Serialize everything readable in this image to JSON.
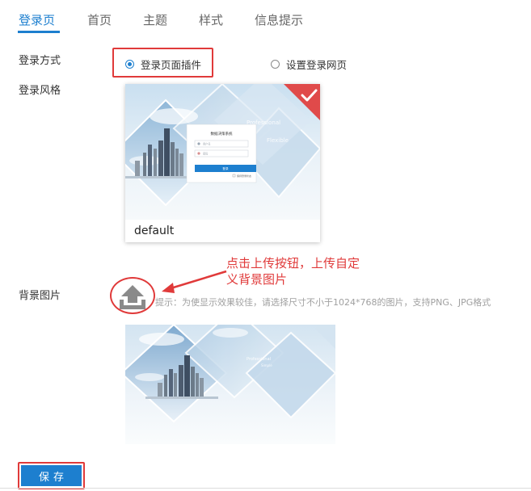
{
  "tabs": [
    {
      "label": "登录页",
      "active": true
    },
    {
      "label": "首页",
      "active": false
    },
    {
      "label": "主题",
      "active": false
    },
    {
      "label": "样式",
      "active": false
    },
    {
      "label": "信息提示",
      "active": false
    }
  ],
  "login_method": {
    "label": "登录方式",
    "options": [
      {
        "label": "登录页面插件",
        "selected": true
      },
      {
        "label": "设置登录网页",
        "selected": false
      }
    ]
  },
  "login_style": {
    "label": "登录风格",
    "card": {
      "name": "default",
      "selected": true,
      "mini_form_title": "数据决策系统",
      "username_placeholder": "用户名",
      "password_placeholder": "密码",
      "login_button": "登录",
      "remember_label": "保持登录状态",
      "watermark_text": "Professional",
      "watermark_text2": "Flexible"
    }
  },
  "background": {
    "label": "背景图片",
    "hint": "提示：为使显示效果较佳，请选择尺寸不小于1024*768的图片，支持PNG、JPG格式",
    "callout": "点击上传按钮，上传自定义背景图片",
    "preview_watermark": "Professional",
    "preview_watermark2": "Simple"
  },
  "save_label": "保存",
  "colors": {
    "accent": "#1d7fcf",
    "annotation": "#e03a3a"
  }
}
